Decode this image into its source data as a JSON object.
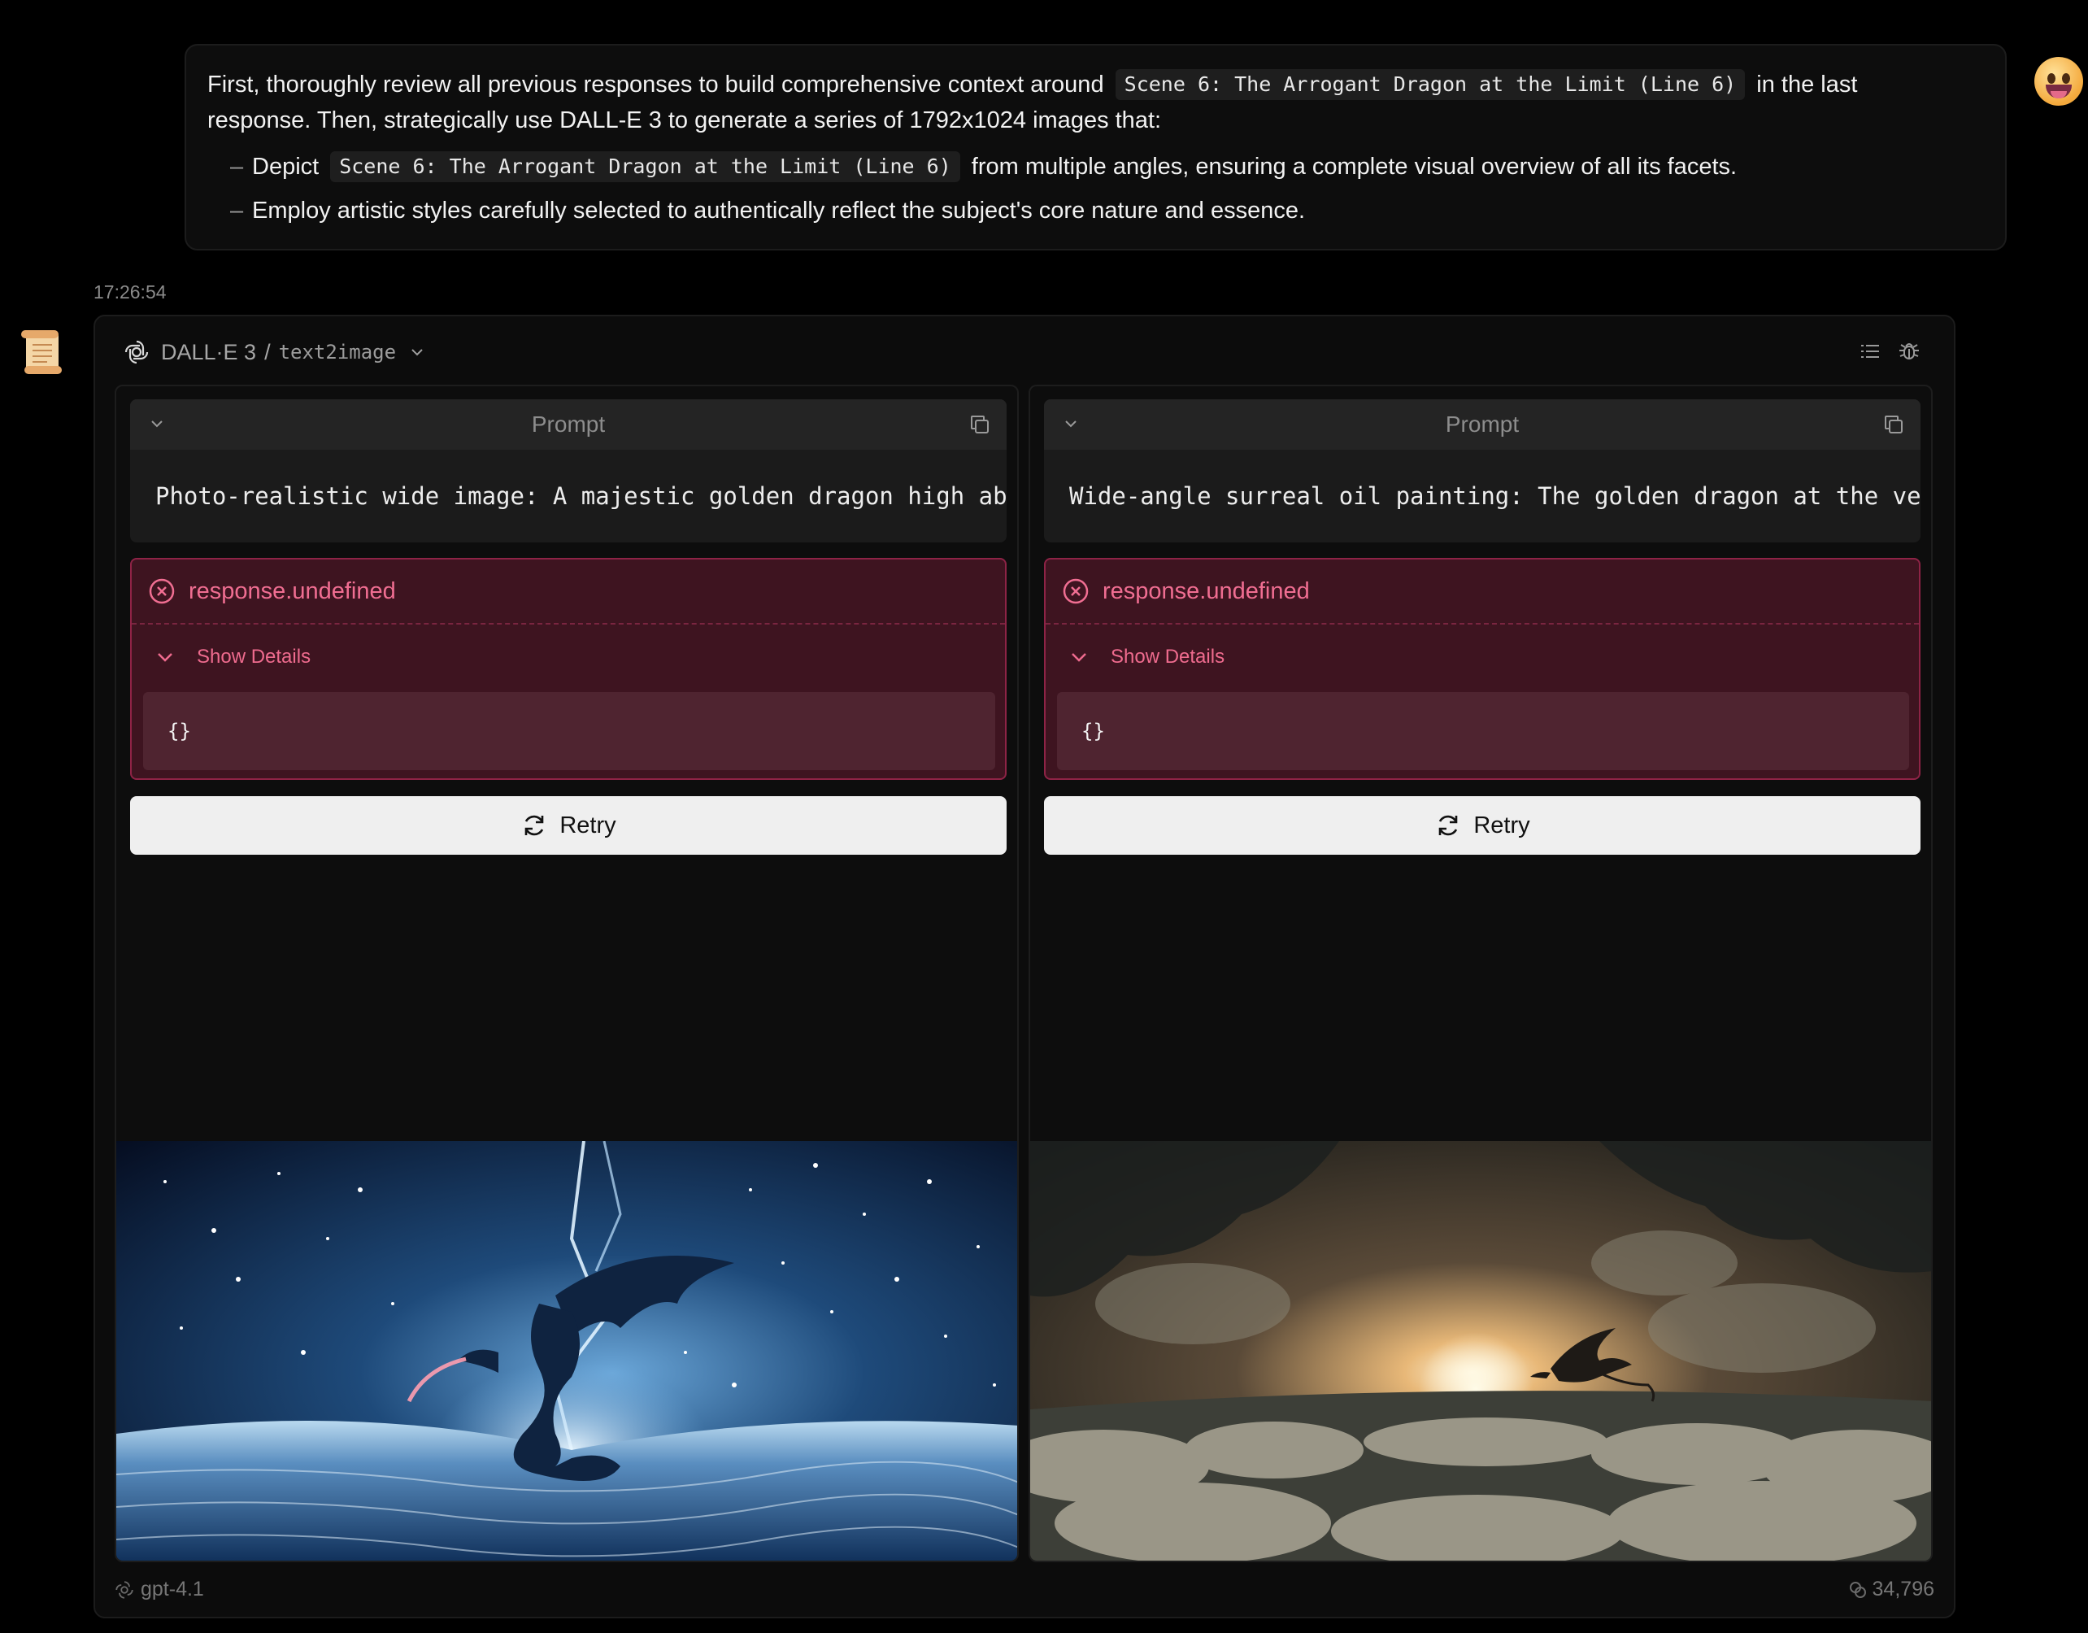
{
  "user_message": {
    "line1_prefix": "First, thoroughly review all previous responses to build comprehensive context around",
    "scene_chip": "Scene 6: The Arrogant Dragon at the Limit (Line 6)",
    "line1_suffix": "in the last",
    "line2": "response. Then, strategically use DALL-E 3 to generate a series of 1792x1024 images that:",
    "bullets": [
      {
        "prefix": "Depict",
        "chip": "Scene 6: The Arrogant Dragon at the Limit (Line 6)",
        "suffix": "from multiple angles, ensuring a complete visual overview of all its facets."
      },
      {
        "text": "Employ artistic styles carefully selected to authentically reflect the subject's core nature and essence."
      }
    ],
    "bullet_marker": "–"
  },
  "timestamp": "17:26:54",
  "assistant": {
    "model_label": "DALL·E 3",
    "separator": "/",
    "tool_label": "text2image",
    "columns": [
      {
        "prompt_label": "Prompt",
        "prompt_text": "Photo-realistic wide image: A majestic golden dragon high abov",
        "error_title": "response.undefined",
        "details_label": "Show Details",
        "details_body": "{}",
        "retry_label": "Retry",
        "image_icon": "dragon-over-ocean-night-sky-image"
      },
      {
        "prompt_label": "Prompt",
        "prompt_text": "Wide-angle surreal oil painting: The golden dragon at the very",
        "error_title": "response.undefined",
        "details_label": "Show Details",
        "details_body": "{}",
        "retry_label": "Retry",
        "image_icon": "dragon-over-clouds-sunset-image"
      }
    ],
    "footer": {
      "model": "gpt-4.1",
      "tokens": "34,796"
    }
  },
  "colors": {
    "background": "#000000",
    "error_bg": "#3e1420",
    "error_border": "#8e2346",
    "error_text": "#f06e92",
    "retry_bg": "#efefef"
  }
}
